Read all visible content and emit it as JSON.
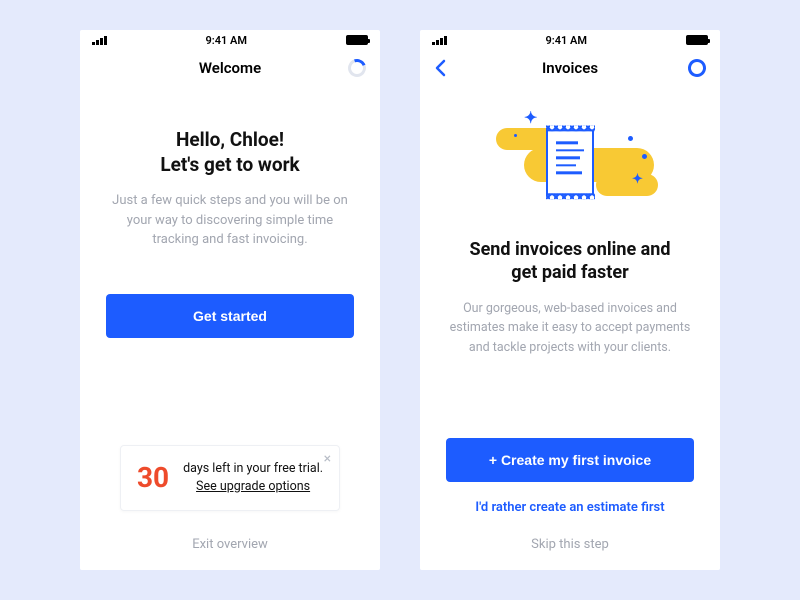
{
  "status": {
    "time": "9:41 AM"
  },
  "screen1": {
    "nav_title": "Welcome",
    "headline": "Hello, Chloe!\nLet's get to work",
    "sub": "Just a few quick steps and you will be on your way to discovering simple time tracking and fast invoicing.",
    "cta": "Get started",
    "trial": {
      "days": "30",
      "text": "days left in your free trial.",
      "upgrade": "See upgrade options"
    },
    "footer": "Exit overview"
  },
  "screen2": {
    "nav_title": "Invoices",
    "headline": "Send invoices online and\nget paid faster",
    "sub": "Our gorgeous, web-based invoices and estimates make it easy to accept payments and tackle projects with your clients.",
    "cta": "+ Create my first invoice",
    "alt": "I'd rather create an estimate first",
    "footer": "Skip this step"
  }
}
